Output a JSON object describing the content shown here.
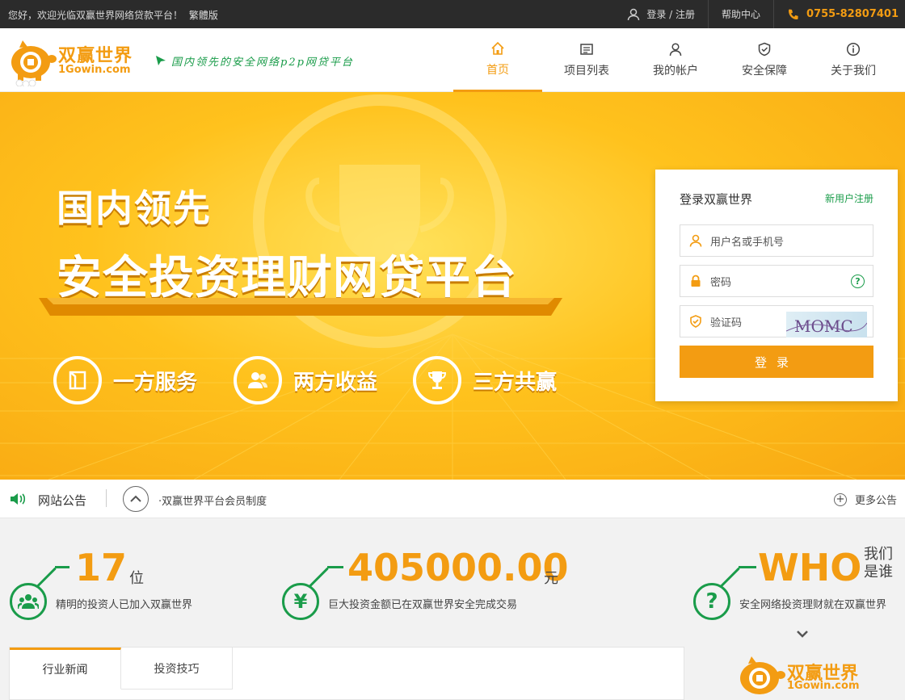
{
  "topbar": {
    "welcome": "您好，欢迎光临双赢世界网络贷款平台！",
    "traditional": "繁體版",
    "login_register": "登录 / 注册",
    "help": "帮助中心",
    "phone": "0755-82807401"
  },
  "header": {
    "logo_cn": "双赢世界",
    "logo_en": "1Gowin.com",
    "slogan": "国内领先的安全网络p2p网贷平台",
    "nav": [
      {
        "label": "首页",
        "icon": "home-icon"
      },
      {
        "label": "项目列表",
        "icon": "list-icon"
      },
      {
        "label": "我的帐户",
        "icon": "user-icon"
      },
      {
        "label": "安全保障",
        "icon": "shield-icon"
      },
      {
        "label": "关于我们",
        "icon": "info-icon"
      }
    ]
  },
  "banner": {
    "title1": "国内领先",
    "title2": "安全投资理财网贷平台",
    "features": [
      "一方服务",
      "两方收益",
      "三方共赢"
    ]
  },
  "login": {
    "title": "登录双赢世界",
    "register_link": "新用户注册",
    "username_placeholder": "用户名或手机号",
    "password_placeholder": "密码",
    "help_glyph": "?",
    "captcha_placeholder": "验证码",
    "captcha_text": "MOMC",
    "button": "登录"
  },
  "notice": {
    "label": "网站公告",
    "message": "·双赢世界平台会员制度",
    "more": "更多公告"
  },
  "stats": [
    {
      "number": "17",
      "unit": "位",
      "desc": "精明的投资人已加入双赢世界",
      "icon": "users-icon"
    },
    {
      "number": "405000.00",
      "unit": "元",
      "desc": "巨大投资金额已在双赢世界安全完成交易",
      "icon": "yen-icon"
    },
    {
      "number": "WHO",
      "unit_line1": "我们",
      "unit_line2": "是谁",
      "desc": "安全网络投资理财就在双赢世界",
      "icon": "question-icon"
    }
  ],
  "tabs": [
    "行业新闻",
    "投资技巧"
  ],
  "colors": {
    "accent": "#f39c12",
    "green": "#1a9c4a",
    "topbar": "#2b2b2b"
  }
}
